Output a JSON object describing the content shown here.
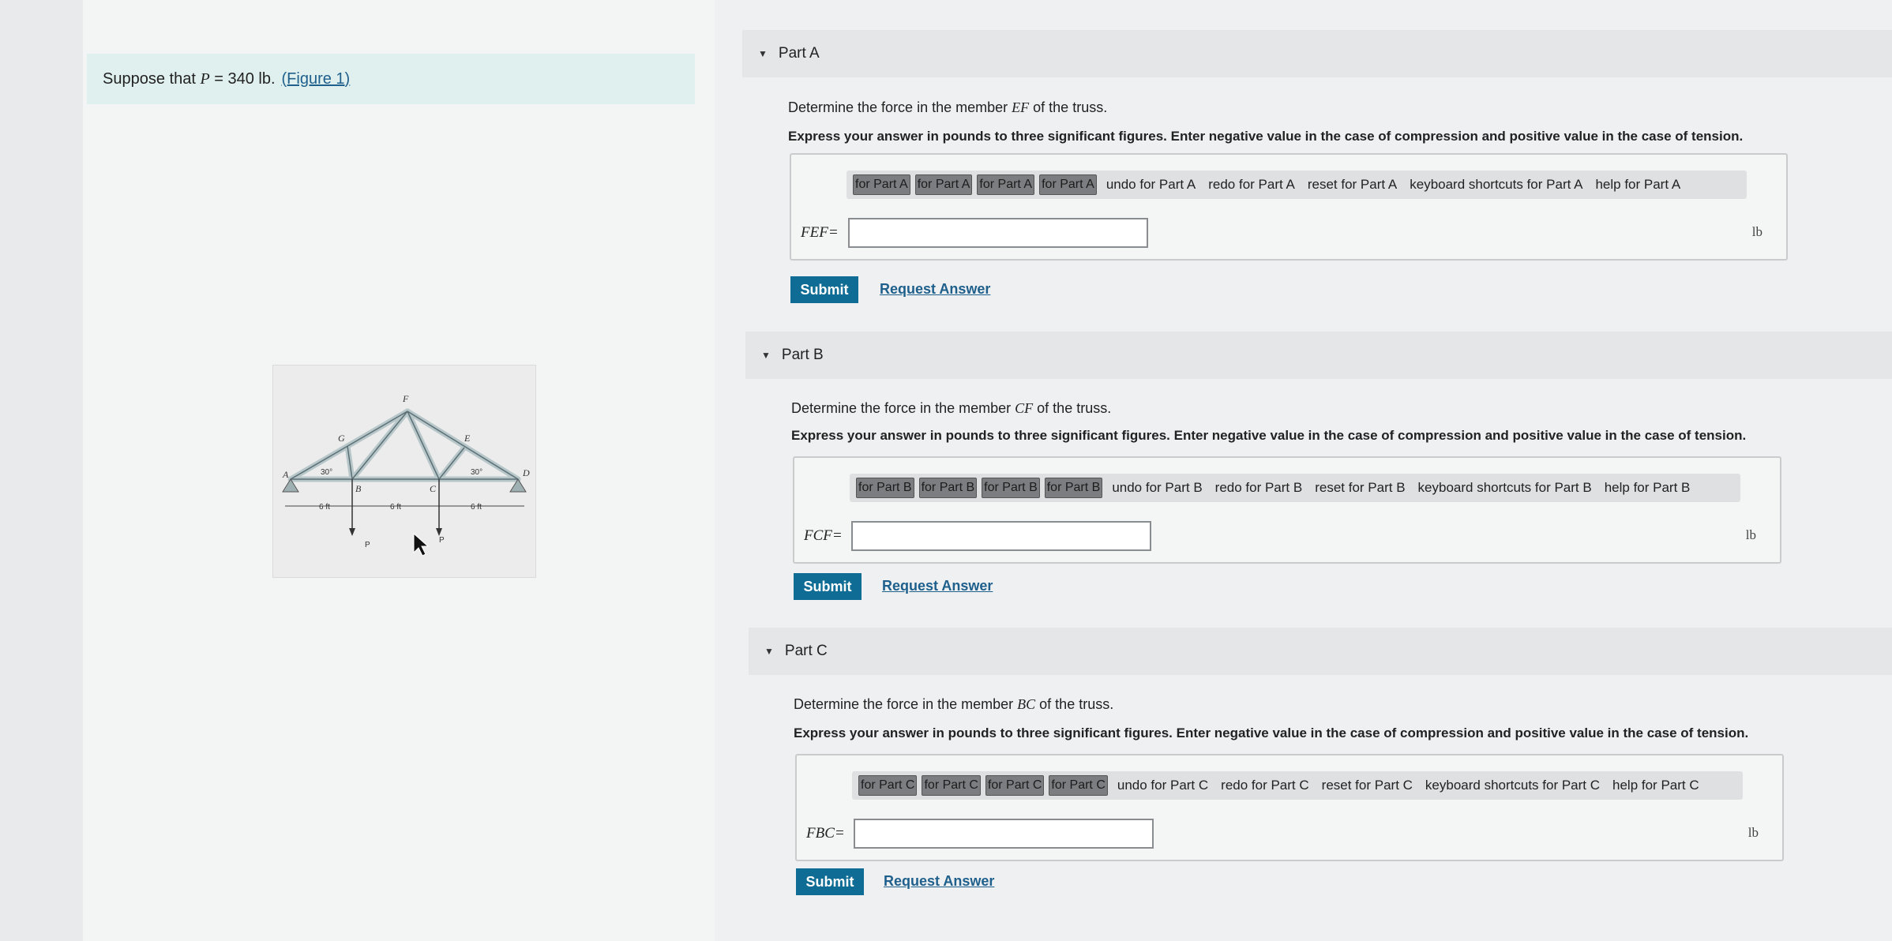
{
  "problem": {
    "text_prefix": "Suppose that",
    "p_var": "P",
    "p_value": "= 340 lb",
    "figure_link": "(Figure 1)"
  },
  "figure": {
    "labels": {
      "A": "A",
      "B": "B",
      "C": "C",
      "D": "D",
      "E": "E",
      "F": "F",
      "G": "G",
      "angle_left": "30°",
      "angle_right": "30°",
      "dim1": "6 ft",
      "dim2": "6 ft",
      "dim3": "6 ft",
      "load1": "P",
      "load2": "P"
    }
  },
  "parts": [
    {
      "title": "Part A",
      "question_prefix": "Determine the force in the member",
      "member": "EF",
      "question_suffix": "of the truss.",
      "instruction": "Express your answer in pounds to three significant figures. Enter negative value in the case of compression and positive value in the case of tension.",
      "tool_buttons": [
        "for Part A",
        "for Part A",
        "for Part A",
        "for Part A"
      ],
      "tool_texts": [
        "undo for Part A",
        "redo for Part A",
        "reset for Part A",
        "keyboard shortcuts for Part A",
        "help for Part A"
      ],
      "var_label": "FEF=",
      "unit": "lb",
      "submit": "Submit",
      "request": "Request Answer"
    },
    {
      "title": "Part B",
      "question_prefix": "Determine the force in the member",
      "member": "CF",
      "question_suffix": "of the truss.",
      "instruction": "Express your answer in pounds to three significant figures. Enter negative value in the case of compression and positive value in the case of tension.",
      "tool_buttons": [
        "for Part B",
        "for Part B",
        "for Part B",
        "for Part B"
      ],
      "tool_texts": [
        "undo for Part B",
        "redo for Part B",
        "reset for Part B",
        "keyboard shortcuts for Part B",
        "help for Part B"
      ],
      "var_label": "FCF=",
      "unit": "lb",
      "submit": "Submit",
      "request": "Request Answer"
    },
    {
      "title": "Part C",
      "question_prefix": "Determine the force in the member",
      "member": "BC",
      "question_suffix": "of the truss.",
      "instruction": "Express your answer in pounds to three significant figures. Enter negative value in the case of compression and positive value in the case of tension.",
      "tool_buttons": [
        "for Part C",
        "for Part C",
        "for Part C",
        "for Part C"
      ],
      "tool_texts": [
        "undo for Part C",
        "redo for Part C",
        "reset for Part C",
        "keyboard shortcuts for Part C",
        "help for Part C"
      ],
      "var_label": "FBC=",
      "unit": "lb",
      "submit": "Submit",
      "request": "Request Answer"
    }
  ]
}
